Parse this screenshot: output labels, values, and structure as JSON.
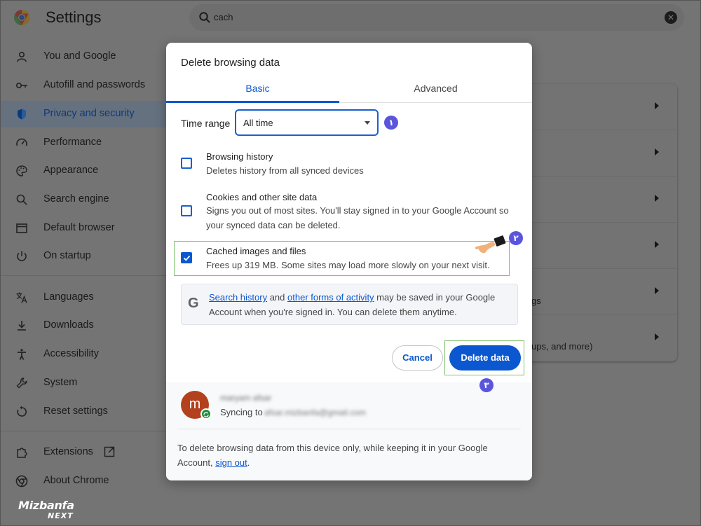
{
  "app": {
    "title": "Settings"
  },
  "search": {
    "value": "cach",
    "clear_label": "✕"
  },
  "sidebar": {
    "items": [
      {
        "label": "You and Google",
        "icon": "person-icon"
      },
      {
        "label": "Autofill and passwords",
        "icon": "key-icon"
      },
      {
        "label": "Privacy and security",
        "icon": "shield-icon",
        "active": true
      },
      {
        "label": "Performance",
        "icon": "speedometer-icon"
      },
      {
        "label": "Appearance",
        "icon": "palette-icon"
      },
      {
        "label": "Search engine",
        "icon": "search-icon"
      },
      {
        "label": "Default browser",
        "icon": "browser-icon"
      },
      {
        "label": "On startup",
        "icon": "power-icon"
      },
      {
        "label": "Languages",
        "icon": "translate-icon"
      },
      {
        "label": "Downloads",
        "icon": "download-icon"
      },
      {
        "label": "Accessibility",
        "icon": "accessibility-icon"
      },
      {
        "label": "System",
        "icon": "wrench-icon"
      },
      {
        "label": "Reset settings",
        "icon": "reset-icon"
      },
      {
        "label": "Extensions",
        "icon": "puzzle-icon"
      },
      {
        "label": "About Chrome",
        "icon": "chrome-icon"
      }
    ]
  },
  "background": {
    "row5_text": "gs",
    "row6_text": "ups, and more)"
  },
  "dialog": {
    "title": "Delete browsing data",
    "tabs": {
      "basic": "Basic",
      "advanced": "Advanced"
    },
    "time_range": {
      "label": "Time range",
      "value": "All time"
    },
    "options": [
      {
        "title": "Browsing history",
        "description": "Deletes history from all synced devices",
        "checked": false
      },
      {
        "title": "Cookies and other site data",
        "description": "Signs you out of most sites. You'll stay signed in to your Google Account so your synced data can be deleted.",
        "checked": false
      },
      {
        "title": "Cached images and files",
        "description": "Frees up 319 MB. Some sites may load more slowly on your next visit.",
        "checked": true
      }
    ],
    "info": {
      "logo": "G",
      "link1": "Search history",
      "and": " and ",
      "link2": "other forms of activity",
      "rest": " may be saved in your Google Account when you're signed in. You can delete them anytime."
    },
    "buttons": {
      "cancel": "Cancel",
      "delete": "Delete data"
    },
    "account": {
      "avatar_letter": "m",
      "name": "maryam afsar",
      "sync_label": "Syncing to",
      "email": "afsar.mizbanfa@gmail.com"
    },
    "footer": {
      "text": "To delete browsing data from this device only, while keeping it in your Google Account, ",
      "link": "sign out",
      "end": "."
    }
  },
  "annotations": {
    "step1": "١",
    "step2": "٢",
    "step3": "٣"
  },
  "watermark": {
    "top": "Mizbanfa",
    "bottom": "NEXT"
  },
  "colors": {
    "accent": "#0b57d0",
    "step_badge": "#5b55dc",
    "highlight": "#7fc36e",
    "overlay": "#747474"
  }
}
